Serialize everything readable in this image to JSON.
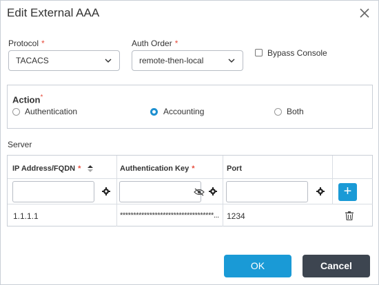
{
  "dialog": {
    "title": "Edit External AAA"
  },
  "protocol": {
    "label": "Protocol",
    "value": "TACACS"
  },
  "auth_order": {
    "label": "Auth Order",
    "value": "remote-then-local"
  },
  "bypass_console": {
    "label": "Bypass Console",
    "checked": false
  },
  "action": {
    "title": "Action",
    "options": [
      {
        "label": "Authentication",
        "selected": false
      },
      {
        "label": "Accounting",
        "selected": true
      },
      {
        "label": "Both",
        "selected": false
      }
    ]
  },
  "server": {
    "label": "Server",
    "columns": [
      "IP Address/FQDN",
      "Authentication Key",
      "Port"
    ],
    "rows": [
      {
        "ip": "1.1.1.1",
        "key": "***********************************...",
        "port": "1234"
      }
    ]
  },
  "required_marker": "*",
  "buttons": {
    "ok": "OK",
    "cancel": "Cancel",
    "add": "+"
  },
  "colors": {
    "accent": "#1a9ad6",
    "required": "#e74c3c",
    "cancel_bg": "#3d4550"
  }
}
